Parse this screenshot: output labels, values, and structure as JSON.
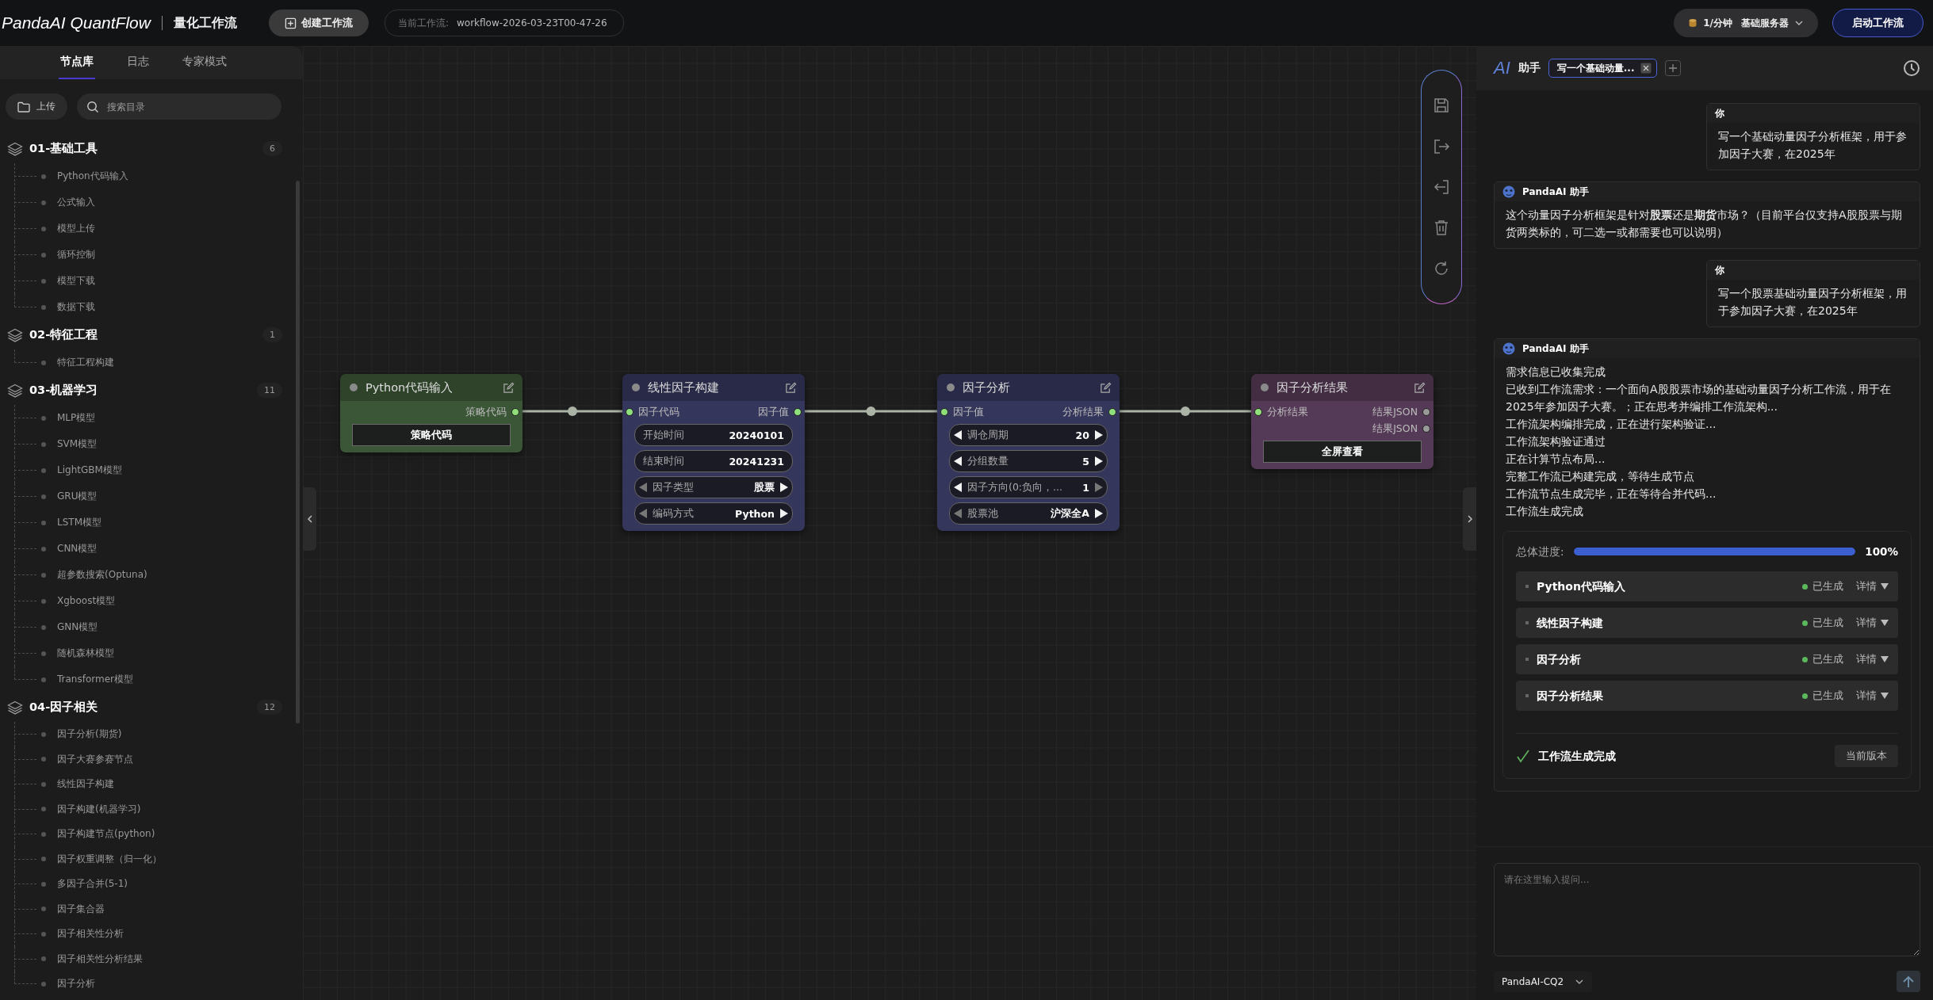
{
  "header": {
    "brand": "PandaAI QuantFlow",
    "subtitle": "量化工作流",
    "create_button": "创建工作流",
    "current_workflow": {
      "label": "当前工作流:",
      "value": "workflow-2026-03-23T00-47-26"
    },
    "rate": "1/分钟",
    "server": "基础服务器",
    "start_button": "启动工作流"
  },
  "sidebar": {
    "tabs": [
      {
        "label": "节点库",
        "selected": true
      },
      {
        "label": "日志",
        "selected": false
      },
      {
        "label": "专家模式",
        "selected": false
      }
    ],
    "upload_button": "上传",
    "search": {
      "placeholder": "搜索目录"
    },
    "groups": [
      {
        "name": "01-基础工具",
        "count": "6",
        "items": [
          "Python代码输入",
          "公式输入",
          "模型上传",
          "循环控制",
          "模型下载",
          "数据下载"
        ]
      },
      {
        "name": "02-特征工程",
        "count": "1",
        "items": [
          "特征工程构建"
        ]
      },
      {
        "name": "03-机器学习",
        "count": "11",
        "items": [
          "MLP模型",
          "SVM模型",
          "LightGBM模型",
          "GRU模型",
          "LSTM模型",
          "CNN模型",
          "超参数搜索(Optuna)",
          "Xgboost模型",
          "GNN模型",
          "随机森林模型",
          "Transformer模型"
        ]
      },
      {
        "name": "04-因子相关",
        "count": "12",
        "items": [
          "因子分析(期货)",
          "因子大赛参赛节点",
          "线性因子构建",
          "因子构建(机器学习)",
          "因子构建节点(python)",
          "因子权重调整（归一化）",
          "多因子合并(5-1)",
          "因子集合器",
          "因子相关性分析",
          "因子相关性分析结果",
          "因子分析"
        ]
      }
    ]
  },
  "canvas": {
    "nodes": [
      {
        "title": "Python代码输入",
        "color": "#3b5636",
        "outputs": [
          {
            "label": "策略代码",
            "connected": true
          }
        ],
        "fields": [
          {
            "kind": "button",
            "value": "策略代码"
          }
        ]
      },
      {
        "title": "线性因子构建",
        "color": "#35365c",
        "inputs": [
          {
            "label": "因子代码",
            "connected": true
          }
        ],
        "outputs": [
          {
            "label": "因子值",
            "connected": true
          }
        ],
        "fields": [
          {
            "kind": "text",
            "label": "开始时间",
            "value": "20240101"
          },
          {
            "kind": "text",
            "label": "结束时间",
            "value": "20241231"
          },
          {
            "kind": "stepper",
            "label": "因子类型",
            "value": "股票",
            "prev_disabled": true,
            "next_disabled": false
          },
          {
            "kind": "stepper",
            "label": "编码方式",
            "value": "Python",
            "prev_disabled": true,
            "next_disabled": false
          }
        ]
      },
      {
        "title": "因子分析",
        "color": "#35365c",
        "inputs": [
          {
            "label": "因子值",
            "connected": true
          }
        ],
        "outputs": [
          {
            "label": "分析结果",
            "connected": true
          }
        ],
        "fields": [
          {
            "kind": "stepper",
            "label": "调仓周期",
            "value": "20",
            "prev_disabled": false,
            "next_disabled": false
          },
          {
            "kind": "stepper",
            "label": "分组数量",
            "value": "5",
            "prev_disabled": false,
            "next_disabled": false
          },
          {
            "kind": "stepper",
            "label": "因子方向(0:负向，...",
            "value": "1",
            "prev_disabled": false,
            "next_disabled": true
          },
          {
            "kind": "stepper",
            "label": "股票池",
            "value": "沪深全A",
            "prev_disabled": true,
            "next_disabled": false
          }
        ]
      },
      {
        "title": "因子分析结果",
        "color": "#553a57",
        "inputs": [
          {
            "label": "分析结果",
            "connected": true
          }
        ],
        "outputs": [
          {
            "label": "结果JSON",
            "connected": false
          },
          {
            "label": "结果JSON",
            "connected": false
          }
        ],
        "fields": [
          {
            "kind": "button",
            "value": "全屏查看"
          }
        ]
      }
    ]
  },
  "assistant": {
    "logo": "AI",
    "title": "助手",
    "session_tab": "写一个基础动量...",
    "messages": [
      {
        "kind": "user",
        "sender": "你",
        "text": "写一个基础动量因子分析框架，用于参加因子大赛，在2025年"
      },
      {
        "kind": "assistant",
        "sender": "PandaAI 助手",
        "text": "这个动量因子分析框架是针对**股票**还是**期货**市场？（目前平台仅支持A股股票与期货两类标的，可二选一或都需要也可以说明）"
      },
      {
        "kind": "user",
        "sender": "你",
        "text": "写一个股票基础动量因子分析框架，用于参加因子大赛，在2025年"
      },
      {
        "kind": "assistant",
        "sender": "PandaAI 助手",
        "lines": [
          "需求信息已收集完成",
          "已收到工作流需求：一个面向A股股票市场的基础动量因子分析工作流，用于在2025年参加因子大赛。；正在思考并编排工作流架构...",
          "工作流架构编排完成，正在进行架构验证...",
          "工作流架构验证通过",
          "正在计算节点布局...",
          "完整工作流已构建完成，等待生成节点",
          "工作流节点生成完毕，正在等待合并代码...",
          "工作流生成完成"
        ],
        "workflow": {
          "progress_label": "总体进度:",
          "level": 1,
          "reading": "100%",
          "steps": [
            {
              "name": "Python代码输入",
              "status": "已生成",
              "details": "详情"
            },
            {
              "name": "线性因子构建",
              "status": "已生成",
              "details": "详情"
            },
            {
              "name": "因子分析",
              "status": "已生成",
              "details": "详情"
            },
            {
              "name": "因子分析结果",
              "status": "已生成",
              "details": "详情"
            }
          ],
          "done": "工作流生成完成",
          "version_button": "当前版本"
        }
      }
    ],
    "input": {
      "placeholder": "请在这里输入提问..."
    },
    "model": "PandaAI-CQ2"
  }
}
